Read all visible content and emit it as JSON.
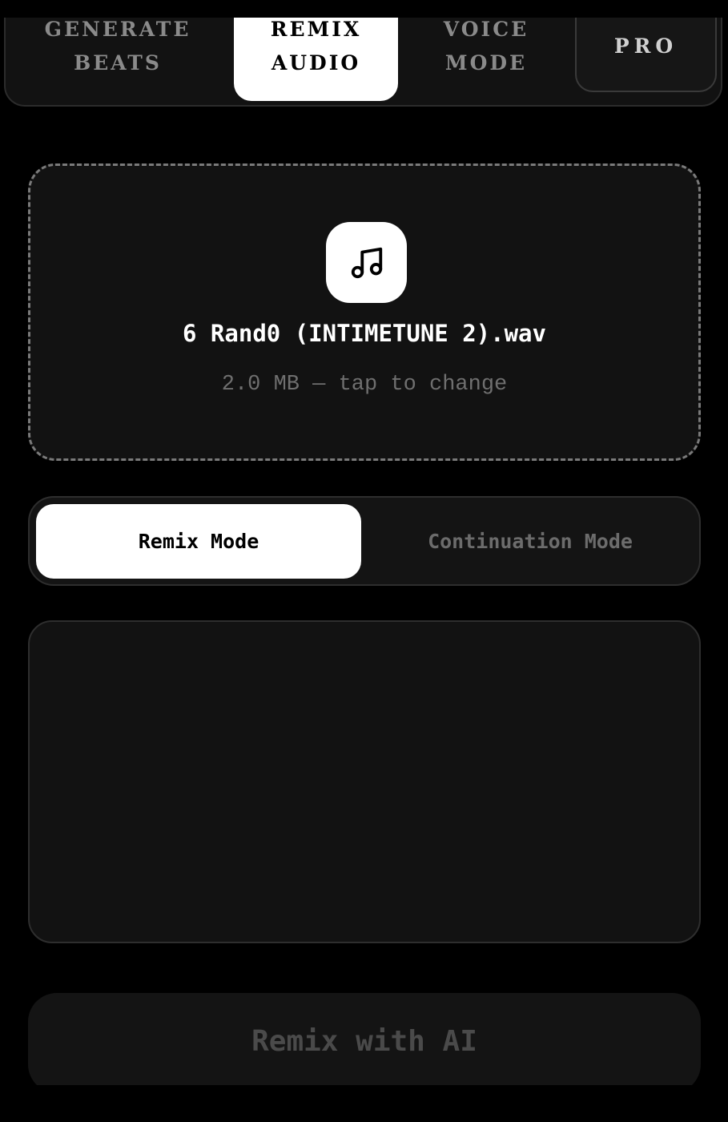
{
  "tabs": [
    {
      "label": "GENERATE\nBEATS",
      "active": false
    },
    {
      "label": "REMIX\nAUDIO",
      "active": true
    },
    {
      "label": "VOICE\nMODE",
      "active": false
    },
    {
      "label": "PRO",
      "active": false
    }
  ],
  "upload": {
    "icon": "music-note-icon",
    "file_name": "6 Rand0 (INTIMETUNE 2).wav",
    "file_meta": "2.0 MB — tap to change"
  },
  "modes": {
    "remix_label": "Remix Mode",
    "continuation_label": "Continuation Mode",
    "selected": "Remix Mode"
  },
  "prompt": {
    "value": "",
    "placeholder": ""
  },
  "action": {
    "label": "Remix with AI",
    "enabled": false
  },
  "colors": {
    "background": "#000000",
    "surface": "#121212",
    "active": "#ffffff",
    "muted_text": "#6c6c6c",
    "disabled_text": "#4a4a4a"
  }
}
